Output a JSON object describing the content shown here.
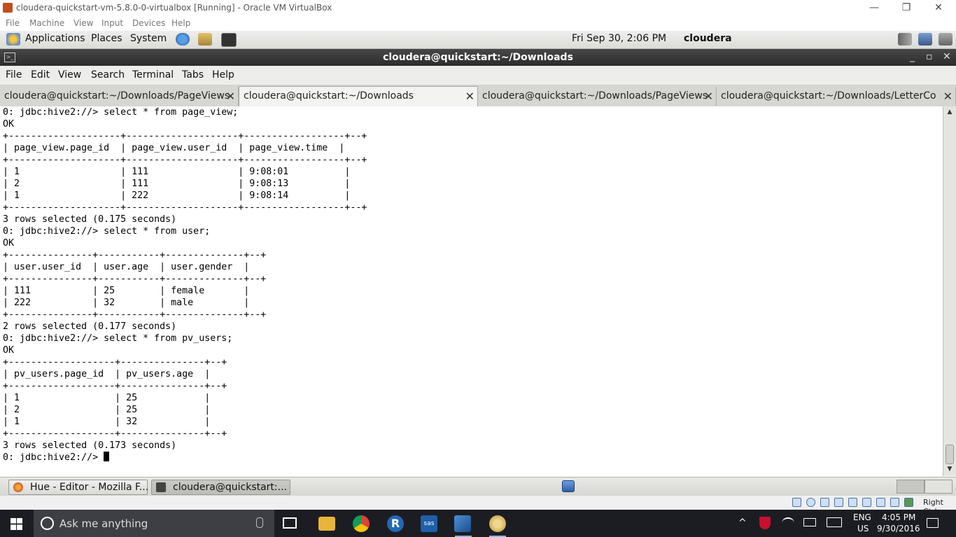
{
  "vbox": {
    "title": "cloudera-quickstart-vm-5.8.0-0-virtualbox [Running] - Oracle VM VirtualBox",
    "controls": {
      "minimize": "—",
      "restore": "❐",
      "close": "✕"
    },
    "menu": [
      "File",
      "Machine",
      "View",
      "Input",
      "Devices",
      "Help"
    ],
    "status_right": "Right Ctrl"
  },
  "gnome_top": {
    "menus": [
      "Applications",
      "Places",
      "System"
    ],
    "clock": "Fri Sep 30,  2:06 PM",
    "user": "cloudera"
  },
  "terminal": {
    "title": "cloudera@quickstart:~/Downloads",
    "title_controls": {
      "minimize": "_",
      "maximize": "▫",
      "close": "✕"
    },
    "menu": [
      "File",
      "Edit",
      "View",
      "Search",
      "Terminal",
      "Tabs",
      "Help"
    ],
    "tabs": [
      {
        "label": "cloudera@quickstart:~/Downloads/PageViews",
        "close": "✕"
      },
      {
        "label": "cloudera@quickstart:~/Downloads",
        "close": "✕"
      },
      {
        "label": "cloudera@quickstart:~/Downloads/PageViews",
        "close": "✕"
      },
      {
        "label": "cloudera@quickstart:~/Downloads/LetterCo...",
        "close": "✕"
      }
    ],
    "output_lines": [
      "0: jdbc:hive2://> select * from page_view;",
      "OK",
      "+--------------------+--------------------+------------------+--+",
      "| page_view.page_id  | page_view.user_id  | page_view.time  |",
      "+--------------------+--------------------+------------------+--+",
      "| 1                  | 111                | 9:08:01          |",
      "| 2                  | 111                | 9:08:13          |",
      "| 1                  | 222                | 9:08:14          |",
      "+--------------------+--------------------+------------------+--+",
      "3 rows selected (0.175 seconds)",
      "0: jdbc:hive2://> select * from user;",
      "OK",
      "+---------------+-----------+--------------+--+",
      "| user.user_id  | user.age  | user.gender  |",
      "+---------------+-----------+--------------+--+",
      "| 111           | 25        | female       |",
      "| 222           | 32        | male         |",
      "+---------------+-----------+--------------+--+",
      "2 rows selected (0.177 seconds)",
      "0: jdbc:hive2://> select * from pv_users;",
      "OK",
      "+-------------------+---------------+--+",
      "| pv_users.page_id  | pv_users.age  |",
      "+-------------------+---------------+--+",
      "| 1                 | 25            |",
      "| 2                 | 25            |",
      "| 1                 | 32            |",
      "+-------------------+---------------+--+",
      "3 rows selected (0.173 seconds)"
    ],
    "prompt": "0: jdbc:hive2://> "
  },
  "gnome_bottom": {
    "tasks": [
      "Hue - Editor - Mozilla F...",
      "cloudera@quickstart:..."
    ]
  },
  "windows_taskbar": {
    "search_placeholder": "Ask me anything",
    "lang": "ENG",
    "region": "US",
    "time": "4:05 PM",
    "date": "9/30/2016"
  }
}
